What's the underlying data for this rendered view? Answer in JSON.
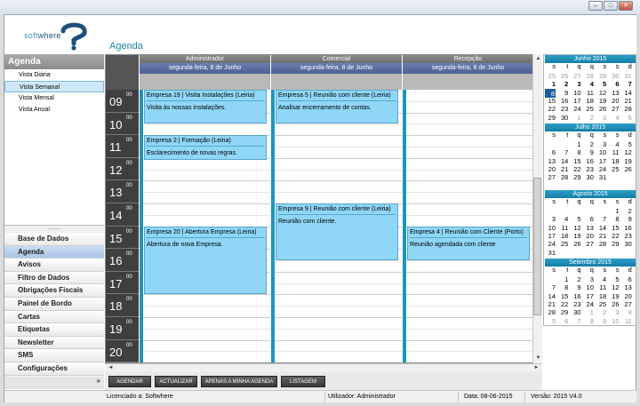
{
  "window": {
    "controls": {
      "minimize": "–",
      "maximize": "□",
      "close": "✕"
    }
  },
  "logo": {
    "text_a": "soft",
    "text_b": "where"
  },
  "sidebar": {
    "header": "Agenda",
    "views": [
      {
        "label": "Vista Diária"
      },
      {
        "label": "Vista Semanal",
        "selected": true
      },
      {
        "label": "Vista Mensal"
      },
      {
        "label": "Vista Anual"
      }
    ],
    "grip": "........",
    "nav": [
      {
        "label": "Base de Dados"
      },
      {
        "label": "Agenda",
        "selected": true
      },
      {
        "label": "Avisos"
      },
      {
        "label": "Filtro de Dados"
      },
      {
        "label": "Obrigações Fiscais"
      },
      {
        "label": "Painel de Bordo"
      },
      {
        "label": "Cartas"
      },
      {
        "label": "Etiquetas"
      },
      {
        "label": "Newsletter"
      },
      {
        "label": "SMS"
      },
      {
        "label": "Configurações"
      }
    ],
    "more": "»"
  },
  "content": {
    "title": "Agenda"
  },
  "schedule": {
    "hours": [
      "09",
      "10",
      "11",
      "12",
      "13",
      "14",
      "15",
      "16",
      "17",
      "18",
      "19",
      "20"
    ],
    "minutes": "00",
    "columns": [
      {
        "name": "Administrador",
        "date": "segunda-feira, 8 de Junho"
      },
      {
        "name": "Comercial",
        "date": "segunda-feira, 8 de Junho"
      },
      {
        "name": "Recepção",
        "date": "segunda-feira, 8 de Junho"
      }
    ],
    "appointments": [
      {
        "col": 0,
        "start": 9,
        "end": 10.5,
        "subject": "Empresa 19 | Visita Instalações (Leiria)",
        "desc": "Visita às nossas instalações."
      },
      {
        "col": 0,
        "start": 11,
        "end": 12.1,
        "subject": "Empresa 2 | Formação (Leiria)",
        "desc": "Esclarecimento de novas regras."
      },
      {
        "col": 0,
        "start": 15,
        "end": 18,
        "subject": "Empresa 20 | Abertura Empresa (Leiria)",
        "desc": "Abertura de nova Empresa."
      },
      {
        "col": 1,
        "start": 9,
        "end": 10.5,
        "subject": "Empresa 5 | Reunião com cliente (Leiria)",
        "desc": "Analisar encerramento de contas."
      },
      {
        "col": 1,
        "start": 14,
        "end": 16.5,
        "subject": "Empresa 9 | Reunião com cliente (Leiria)",
        "desc": "Reunião com cliente."
      },
      {
        "col": 2,
        "start": 15,
        "end": 16.5,
        "subject": "Empresa 4 | Reunião com Cliente (Porto)",
        "desc": "Reunião agendada com cliente"
      }
    ]
  },
  "toolbar": {
    "agendar": "AGENDAR",
    "actualizar": "ACTUALIZAR",
    "apenas": "APENAS A MINHA AGENDA",
    "listagem": "LISTAGEM"
  },
  "minicals": {
    "dow": [
      "s",
      "t",
      "q",
      "q",
      "s",
      "s",
      "d"
    ],
    "prev": "◄",
    "next": "►",
    "months": [
      {
        "title": "Junho 2015",
        "start": 0,
        "days": 30,
        "prev_tail": [],
        "next_head": [
          1,
          2,
          3,
          4,
          5
        ],
        "today": 8,
        "bold_week": [
          1,
          2,
          3,
          4,
          5,
          6,
          7
        ],
        "extra_prev": [
          25,
          26,
          27,
          28,
          29,
          30,
          31
        ]
      },
      {
        "title": "Julho 2015",
        "start": 2,
        "days": 31,
        "prev_tail": [],
        "next_head": []
      },
      {
        "title": "Agosto 2015",
        "start": 5,
        "days": 31,
        "prev_tail": [],
        "next_head": []
      },
      {
        "title": "Setembro 2015",
        "start": 1,
        "days": 30,
        "prev_tail": [],
        "next_head": [
          1,
          2,
          3,
          4,
          5,
          6,
          7,
          8,
          9,
          10,
          11
        ]
      }
    ]
  },
  "status": {
    "licence": "Licenciado a: Softwhere",
    "user": "Utilizador: Administrador",
    "date": "Data: 08-06-2015",
    "version": "Versão: 2015 V4.0"
  }
}
